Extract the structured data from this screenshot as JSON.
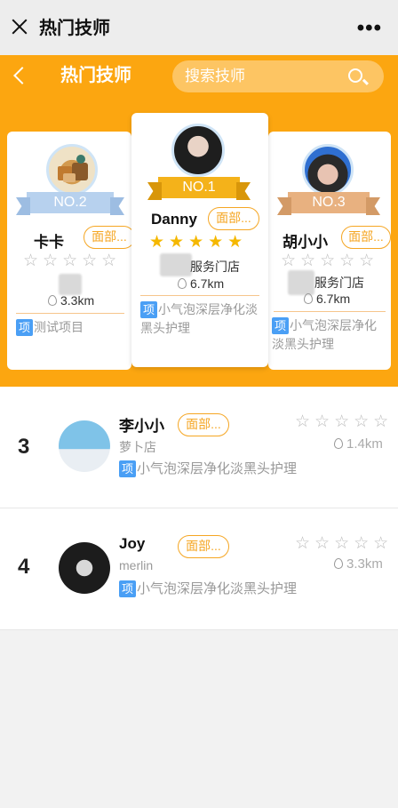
{
  "window": {
    "title": "热门技师",
    "close_icon": "close-icon",
    "more": "•••"
  },
  "header": {
    "title": "热门技师",
    "search_placeholder": "搜索技师"
  },
  "podium": [
    {
      "rank_label": "NO.2",
      "name": "卡卡",
      "tag": "面部...",
      "rating": 0,
      "distance": "3.3km",
      "service_badge": "项",
      "service": "测试项目"
    },
    {
      "rank_label": "NO.1",
      "name": "Danny",
      "tag": "面部...",
      "rating": 5,
      "store": "服务门店",
      "distance": "6.7km",
      "service_badge": "项",
      "service": "小气泡深层净化淡黑头护理"
    },
    {
      "rank_label": "NO.3",
      "name": "胡小小",
      "tag": "面部...",
      "rating": 0,
      "store": "服务门店",
      "distance": "6.7km",
      "service_badge": "项",
      "service": "小气泡深层净化淡黑头护理"
    }
  ],
  "list": [
    {
      "rank": "3",
      "name": "李小小",
      "tag": "面部...",
      "store": "萝卜店",
      "rating": 0,
      "distance": "1.4km",
      "service_badge": "项",
      "service": "小气泡深层净化淡黑头护理"
    },
    {
      "rank": "4",
      "name": "Joy",
      "tag": "面部...",
      "store": "merlin",
      "rating": 0,
      "distance": "3.3km",
      "service_badge": "项",
      "service": "小气泡深层净化淡黑头护理"
    }
  ],
  "colors": {
    "accent": "#fca610",
    "tag": "#f5a623",
    "badge": "#4a9ff5",
    "star": "#f5b800"
  },
  "stars": {
    "empty": "☆☆☆☆☆",
    "full": "★★★★★"
  }
}
